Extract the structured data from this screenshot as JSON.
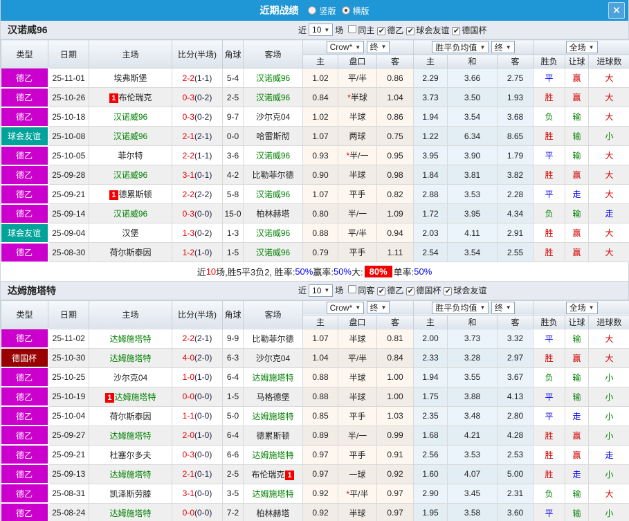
{
  "icons": {
    "close": "✕",
    "check": "✔",
    "arrow": "▼"
  },
  "colors": {
    "topbar": "#1f96d5",
    "type_map": {
      "德乙": "#cc00cc",
      "球会友谊": "#00a39a",
      "德国杯": "#990000"
    },
    "result_map": {
      "胜": "res-r",
      "平": "res-b",
      "负": "res-g",
      "赢": "res-r",
      "走": "res-b",
      "输": "res-g",
      "大": "res-r",
      "小": "res-g"
    }
  },
  "titlebar": {
    "title": "近期战绩",
    "radio_vertical": "竖版",
    "radio_horizontal": "横版"
  },
  "filter_labels": {
    "recent": "近",
    "matches": "场"
  },
  "table_header": {
    "col_type": "类型",
    "col_date": "日期",
    "col_home": "主场",
    "col_score": "比分(半场)",
    "col_corner": "角球",
    "col_away": "客场",
    "sub_ah_home": "主",
    "sub_ah_line": "盘口",
    "sub_ah_away": "客",
    "sub_eu_home": "主",
    "sub_eu_draw": "和",
    "sub_eu_away": "客",
    "sub_res_wdl": "胜负",
    "sub_res_ah": "让球",
    "sub_res_goals": "进球数",
    "select_company": "Crow*",
    "select_final1": "终",
    "select_avg": "胜平负均值",
    "select_final2": "终",
    "select_fulltime": "全场"
  },
  "sections": [
    {
      "team": "汉诺威96",
      "filter": {
        "count": "10",
        "checks": [
          {
            "label": "同主",
            "checked": false
          },
          {
            "label": "德乙",
            "checked": true
          },
          {
            "label": "球会友谊",
            "checked": true
          },
          {
            "label": "德国杯",
            "checked": true
          }
        ]
      },
      "rows": [
        {
          "type": "德乙",
          "date": "25-11-01",
          "home": "埃弗斯堡",
          "home_focus": false,
          "home_badge": "",
          "score": "2-2",
          "half": "(1-1)",
          "corners": "5-4",
          "away": "汉诺威96",
          "away_focus": true,
          "away_badge": "",
          "ah_home": "1.02",
          "handicap": "平/半",
          "hstar": false,
          "ah_away": "0.86",
          "eu": [
            "2.29",
            "3.66",
            "2.75"
          ],
          "results": [
            "平",
            "赢",
            "大"
          ]
        },
        {
          "type": "德乙",
          "date": "25-10-26",
          "home": "布伦瑞克",
          "home_focus": false,
          "home_badge": "1",
          "score": "0-3",
          "half": "(0-2)",
          "corners": "2-5",
          "away": "汉诺威96",
          "away_focus": true,
          "away_badge": "",
          "ah_home": "0.84",
          "handicap": "半球",
          "hstar": true,
          "ah_away": "1.04",
          "eu": [
            "3.73",
            "3.50",
            "1.93"
          ],
          "results": [
            "胜",
            "赢",
            "大"
          ]
        },
        {
          "type": "德乙",
          "date": "25-10-18",
          "home": "汉诺威96",
          "home_focus": true,
          "home_badge": "",
          "score": "0-3",
          "half": "(0-2)",
          "corners": "9-7",
          "away": "沙尔克04",
          "away_focus": false,
          "away_badge": "",
          "ah_home": "1.02",
          "handicap": "半球",
          "hstar": false,
          "ah_away": "0.86",
          "eu": [
            "1.94",
            "3.54",
            "3.68"
          ],
          "results": [
            "负",
            "输",
            "大"
          ]
        },
        {
          "type": "球会友谊",
          "date": "25-10-08",
          "home": "汉诺威96",
          "home_focus": true,
          "home_badge": "",
          "score": "2-1",
          "half": "(2-1)",
          "corners": "0-0",
          "away": "哈雷斯彻",
          "away_focus": false,
          "away_badge": "",
          "ah_home": "1.07",
          "handicap": "两球",
          "hstar": false,
          "ah_away": "0.75",
          "eu": [
            "1.22",
            "6.34",
            "8.65"
          ],
          "results": [
            "胜",
            "输",
            "小"
          ]
        },
        {
          "type": "德乙",
          "date": "25-10-05",
          "home": "菲尔特",
          "home_focus": false,
          "home_badge": "",
          "score": "2-2",
          "half": "(1-1)",
          "corners": "3-6",
          "away": "汉诺威96",
          "away_focus": true,
          "away_badge": "",
          "ah_home": "0.93",
          "handicap": "半/一",
          "hstar": true,
          "ah_away": "0.95",
          "eu": [
            "3.95",
            "3.90",
            "1.79"
          ],
          "results": [
            "平",
            "输",
            "大"
          ]
        },
        {
          "type": "德乙",
          "date": "25-09-28",
          "home": "汉诺威96",
          "home_focus": true,
          "home_badge": "",
          "score": "3-1",
          "half": "(0-1)",
          "corners": "4-2",
          "away": "比勒菲尔德",
          "away_focus": false,
          "away_badge": "",
          "ah_home": "0.90",
          "handicap": "半球",
          "hstar": false,
          "ah_away": "0.98",
          "eu": [
            "1.84",
            "3.81",
            "3.82"
          ],
          "results": [
            "胜",
            "赢",
            "大"
          ]
        },
        {
          "type": "德乙",
          "date": "25-09-21",
          "home": "德累斯顿",
          "home_focus": false,
          "home_badge": "1",
          "score": "2-2",
          "half": "(2-2)",
          "corners": "5-8",
          "away": "汉诺威96",
          "away_focus": true,
          "away_badge": "",
          "ah_home": "1.07",
          "handicap": "平手",
          "hstar": false,
          "ah_away": "0.82",
          "eu": [
            "2.88",
            "3.53",
            "2.28"
          ],
          "results": [
            "平",
            "走",
            "大"
          ]
        },
        {
          "type": "德乙",
          "date": "25-09-14",
          "home": "汉诺威96",
          "home_focus": true,
          "home_badge": "",
          "score": "0-3",
          "half": "(0-0)",
          "corners": "15-0",
          "away": "柏林赫塔",
          "away_focus": false,
          "away_badge": "",
          "ah_home": "0.80",
          "handicap": "半/一",
          "hstar": false,
          "ah_away": "1.09",
          "eu": [
            "1.72",
            "3.95",
            "4.34"
          ],
          "results": [
            "负",
            "输",
            "走"
          ]
        },
        {
          "type": "球会友谊",
          "date": "25-09-04",
          "home": "汉堡",
          "home_focus": false,
          "home_badge": "",
          "score": "1-3",
          "half": "(0-2)",
          "corners": "1-3",
          "away": "汉诺威96",
          "away_focus": true,
          "away_badge": "",
          "ah_home": "0.88",
          "handicap": "平/半",
          "hstar": false,
          "ah_away": "0.94",
          "eu": [
            "2.03",
            "4.11",
            "2.91"
          ],
          "results": [
            "胜",
            "赢",
            "大"
          ]
        },
        {
          "type": "德乙",
          "date": "25-08-30",
          "home": "荷尔斯泰因",
          "home_focus": false,
          "home_badge": "",
          "score": "1-2",
          "half": "(1-0)",
          "corners": "1-5",
          "away": "汉诺威96",
          "away_focus": true,
          "away_badge": "",
          "ah_home": "0.79",
          "handicap": "平手",
          "hstar": false,
          "ah_away": "1.11",
          "eu": [
            "2.54",
            "3.54",
            "2.55"
          ],
          "results": [
            "胜",
            "赢",
            "大"
          ]
        }
      ],
      "summary_parts": [
        {
          "t": "近",
          "c": "p-k"
        },
        {
          "t": "10",
          "c": "p-r"
        },
        {
          "t": "场,胜5平3负2, 胜率:",
          "c": "p-k"
        },
        {
          "t": "50%",
          "c": "p-b"
        },
        {
          "t": " 赢率:",
          "c": "p-k"
        },
        {
          "t": "50%",
          "c": "p-b"
        },
        {
          "t": " 大:",
          "c": "p-k"
        },
        {
          "t": "80%",
          "c": "p-hl"
        },
        {
          "t": " 单率:",
          "c": "p-k"
        },
        {
          "t": "50%",
          "c": "p-b"
        }
      ]
    },
    {
      "team": "达姆施塔特",
      "filter": {
        "count": "10",
        "checks": [
          {
            "label": "同客",
            "checked": false
          },
          {
            "label": "德乙",
            "checked": true
          },
          {
            "label": "德国杯",
            "checked": true
          },
          {
            "label": "球会友谊",
            "checked": true
          }
        ]
      },
      "rows": [
        {
          "type": "德乙",
          "date": "25-11-02",
          "home": "达姆施塔特",
          "home_focus": true,
          "home_badge": "",
          "score": "2-2",
          "half": "(2-1)",
          "corners": "9-9",
          "away": "比勒菲尔德",
          "away_focus": false,
          "away_badge": "",
          "ah_home": "1.07",
          "handicap": "半球",
          "hstar": false,
          "ah_away": "0.81",
          "eu": [
            "2.00",
            "3.73",
            "3.32"
          ],
          "results": [
            "平",
            "输",
            "大"
          ]
        },
        {
          "type": "德国杯",
          "date": "25-10-30",
          "home": "达姆施塔特",
          "home_focus": true,
          "home_badge": "",
          "score": "4-0",
          "half": "(2-0)",
          "corners": "6-3",
          "away": "沙尔克04",
          "away_focus": false,
          "away_badge": "",
          "ah_home": "1.04",
          "handicap": "平/半",
          "hstar": false,
          "ah_away": "0.84",
          "eu": [
            "2.33",
            "3.28",
            "2.97"
          ],
          "results": [
            "胜",
            "赢",
            "大"
          ]
        },
        {
          "type": "德乙",
          "date": "25-10-25",
          "home": "沙尔克04",
          "home_focus": false,
          "home_badge": "",
          "score": "1-0",
          "half": "(1-0)",
          "corners": "6-4",
          "away": "达姆施塔特",
          "away_focus": true,
          "away_badge": "",
          "ah_home": "0.88",
          "handicap": "半球",
          "hstar": false,
          "ah_away": "1.00",
          "eu": [
            "1.94",
            "3.55",
            "3.67"
          ],
          "results": [
            "负",
            "输",
            "小"
          ]
        },
        {
          "type": "德乙",
          "date": "25-10-19",
          "home": "达姆施塔特",
          "home_focus": true,
          "home_badge": "1",
          "score": "0-0",
          "half": "(0-0)",
          "corners": "1-5",
          "away": "马格德堡",
          "away_focus": false,
          "away_badge": "",
          "ah_home": "0.88",
          "handicap": "半球",
          "hstar": false,
          "ah_away": "1.00",
          "eu": [
            "1.75",
            "3.88",
            "4.13"
          ],
          "results": [
            "平",
            "输",
            "小"
          ]
        },
        {
          "type": "德乙",
          "date": "25-10-04",
          "home": "荷尔斯泰因",
          "home_focus": false,
          "home_badge": "",
          "score": "1-1",
          "half": "(0-0)",
          "corners": "5-0",
          "away": "达姆施塔特",
          "away_focus": true,
          "away_badge": "",
          "ah_home": "0.85",
          "handicap": "平手",
          "hstar": false,
          "ah_away": "1.03",
          "eu": [
            "2.35",
            "3.48",
            "2.80"
          ],
          "results": [
            "平",
            "走",
            "小"
          ]
        },
        {
          "type": "德乙",
          "date": "25-09-27",
          "home": "达姆施塔特",
          "home_focus": true,
          "home_badge": "",
          "score": "2-0",
          "half": "(1-0)",
          "corners": "6-4",
          "away": "德累斯顿",
          "away_focus": false,
          "away_badge": "",
          "ah_home": "0.89",
          "handicap": "半/一",
          "hstar": false,
          "ah_away": "0.99",
          "eu": [
            "1.68",
            "4.21",
            "4.28"
          ],
          "results": [
            "胜",
            "赢",
            "小"
          ]
        },
        {
          "type": "德乙",
          "date": "25-09-21",
          "home": "杜塞尔多夫",
          "home_focus": false,
          "home_badge": "",
          "score": "0-3",
          "half": "(0-0)",
          "corners": "6-6",
          "away": "达姆施塔特",
          "away_focus": true,
          "away_badge": "",
          "ah_home": "0.97",
          "handicap": "平手",
          "hstar": false,
          "ah_away": "0.91",
          "eu": [
            "2.56",
            "3.53",
            "2.53"
          ],
          "results": [
            "胜",
            "赢",
            "走"
          ]
        },
        {
          "type": "德乙",
          "date": "25-09-13",
          "home": "达姆施塔特",
          "home_focus": true,
          "home_badge": "",
          "score": "2-1",
          "half": "(0-1)",
          "corners": "2-5",
          "away": "布伦瑞克",
          "away_focus": false,
          "away_badge": "1",
          "ah_home": "0.97",
          "handicap": "一球",
          "hstar": false,
          "ah_away": "0.92",
          "eu": [
            "1.60",
            "4.07",
            "5.00"
          ],
          "results": [
            "胜",
            "走",
            "小"
          ]
        },
        {
          "type": "德乙",
          "date": "25-08-31",
          "home": "凯泽斯劳滕",
          "home_focus": false,
          "home_badge": "",
          "score": "3-1",
          "half": "(0-0)",
          "corners": "3-5",
          "away": "达姆施塔特",
          "away_focus": true,
          "away_badge": "",
          "ah_home": "0.92",
          "handicap": "平/半",
          "hstar": true,
          "ah_away": "0.97",
          "eu": [
            "2.90",
            "3.45",
            "2.31"
          ],
          "results": [
            "负",
            "输",
            "大"
          ]
        },
        {
          "type": "德乙",
          "date": "25-08-24",
          "home": "达姆施塔特",
          "home_focus": true,
          "home_badge": "",
          "score": "0-0",
          "half": "(0-0)",
          "corners": "7-2",
          "away": "柏林赫塔",
          "away_focus": false,
          "away_badge": "",
          "ah_home": "0.92",
          "handicap": "半球",
          "hstar": false,
          "ah_away": "0.97",
          "eu": [
            "1.95",
            "3.58",
            "3.60"
          ],
          "results": [
            "平",
            "输",
            "小"
          ]
        }
      ],
      "summary_parts": []
    }
  ]
}
